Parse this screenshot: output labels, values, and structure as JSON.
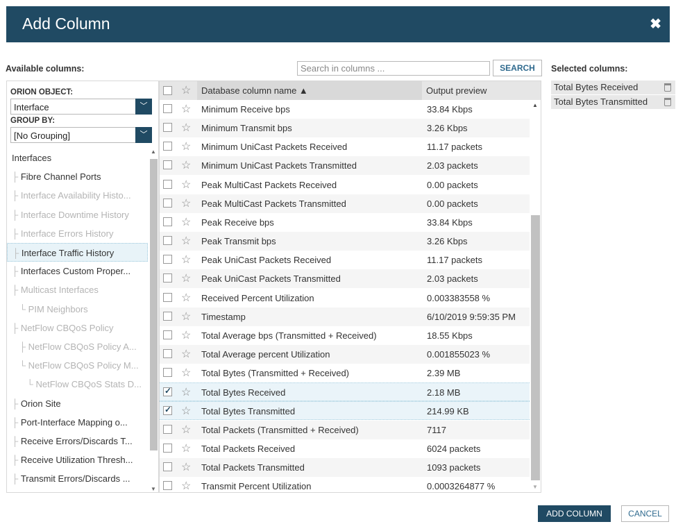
{
  "dialog": {
    "title": "Add Column",
    "close_glyph": "✖"
  },
  "labels": {
    "available": "Available columns:",
    "selected": "Selected columns:"
  },
  "search": {
    "placeholder": "Search in columns ...",
    "button": "SEARCH"
  },
  "left": {
    "orion_object_label": "ORION OBJECT:",
    "orion_object_value": "Interface",
    "group_by_label": "GROUP BY:",
    "group_by_value": "[No Grouping]",
    "tree": [
      {
        "label": "Interfaces",
        "prefix": "",
        "enabled": true,
        "selected": false
      },
      {
        "label": "Fibre Channel Ports",
        "prefix": "├ ",
        "enabled": true,
        "selected": false
      },
      {
        "label": "Interface Availability Histo...",
        "prefix": "├ ",
        "enabled": false,
        "selected": false
      },
      {
        "label": "Interface Downtime History",
        "prefix": "├ ",
        "enabled": false,
        "selected": false
      },
      {
        "label": "Interface Errors History",
        "prefix": "├ ",
        "enabled": false,
        "selected": false
      },
      {
        "label": "Interface Traffic History",
        "prefix": "├ ",
        "enabled": true,
        "selected": true
      },
      {
        "label": "Interfaces Custom Proper...",
        "prefix": "├ ",
        "enabled": true,
        "selected": false
      },
      {
        "label": "Multicast Interfaces",
        "prefix": "├ ",
        "enabled": false,
        "selected": false
      },
      {
        "label": "PIM Neighbors",
        "prefix": "   └ ",
        "enabled": false,
        "selected": false
      },
      {
        "label": "NetFlow CBQoS Policy",
        "prefix": "├ ",
        "enabled": false,
        "selected": false
      },
      {
        "label": "NetFlow CBQoS Policy A...",
        "prefix": "   ├ ",
        "enabled": false,
        "selected": false
      },
      {
        "label": "NetFlow CBQoS Policy M...",
        "prefix": "   └ ",
        "enabled": false,
        "selected": false
      },
      {
        "label": "NetFlow CBQoS Stats D...",
        "prefix": "      └ ",
        "enabled": false,
        "selected": false
      },
      {
        "label": "Orion Site",
        "prefix": "├ ",
        "enabled": true,
        "selected": false
      },
      {
        "label": "Port-Interface Mapping o...",
        "prefix": "├ ",
        "enabled": true,
        "selected": false
      },
      {
        "label": "Receive Errors/Discards T...",
        "prefix": "├ ",
        "enabled": true,
        "selected": false
      },
      {
        "label": "Receive Utilization Thresh...",
        "prefix": "├ ",
        "enabled": true,
        "selected": false
      },
      {
        "label": "Transmit Errors/Discards ...",
        "prefix": "├ ",
        "enabled": true,
        "selected": false
      }
    ]
  },
  "table": {
    "col_name": "Database column name ▲",
    "col_preview": "Output preview",
    "rows": [
      {
        "name": "Minimum Receive bps",
        "preview": "33.84 Kbps",
        "checked": false
      },
      {
        "name": "Minimum Transmit bps",
        "preview": "3.26 Kbps",
        "checked": false
      },
      {
        "name": "Minimum UniCast Packets Received",
        "preview": "11.17 packets",
        "checked": false
      },
      {
        "name": "Minimum UniCast Packets Transmitted",
        "preview": "2.03 packets",
        "checked": false
      },
      {
        "name": "Peak MultiCast Packets Received",
        "preview": "0.00 packets",
        "checked": false
      },
      {
        "name": "Peak MultiCast Packets Transmitted",
        "preview": "0.00 packets",
        "checked": false
      },
      {
        "name": "Peak Receive bps",
        "preview": "33.84 Kbps",
        "checked": false
      },
      {
        "name": "Peak Transmit bps",
        "preview": "3.26 Kbps",
        "checked": false
      },
      {
        "name": "Peak UniCast Packets Received",
        "preview": "11.17 packets",
        "checked": false
      },
      {
        "name": "Peak UniCast Packets Transmitted",
        "preview": "2.03 packets",
        "checked": false
      },
      {
        "name": "Received Percent Utilization",
        "preview": "0.003383558 %",
        "checked": false
      },
      {
        "name": "Timestamp",
        "preview": "6/10/2019 9:59:35 PM",
        "checked": false
      },
      {
        "name": "Total Average bps (Transmitted + Received)",
        "preview": "18.55 Kbps",
        "checked": false
      },
      {
        "name": "Total Average percent Utilization",
        "preview": "0.001855023 %",
        "checked": false
      },
      {
        "name": "Total Bytes (Transmitted + Received)",
        "preview": "2.39 MB",
        "checked": false
      },
      {
        "name": "Total Bytes Received",
        "preview": "2.18 MB",
        "checked": true
      },
      {
        "name": "Total Bytes Transmitted",
        "preview": "214.99 KB",
        "checked": true
      },
      {
        "name": "Total Packets (Transmitted + Received)",
        "preview": "7117",
        "checked": false
      },
      {
        "name": "Total Packets Received",
        "preview": "6024 packets",
        "checked": false
      },
      {
        "name": "Total Packets Transmitted",
        "preview": "1093 packets",
        "checked": false
      },
      {
        "name": "Transmit Percent Utilization",
        "preview": "0.0003264877 %",
        "checked": false
      }
    ]
  },
  "selected_columns": [
    "Total Bytes Received",
    "Total Bytes Transmitted"
  ],
  "footer": {
    "add": "ADD COLUMN",
    "cancel": "CANCEL"
  },
  "colors": {
    "header_bg": "#204a63",
    "accent_text": "#2f6a8e"
  }
}
